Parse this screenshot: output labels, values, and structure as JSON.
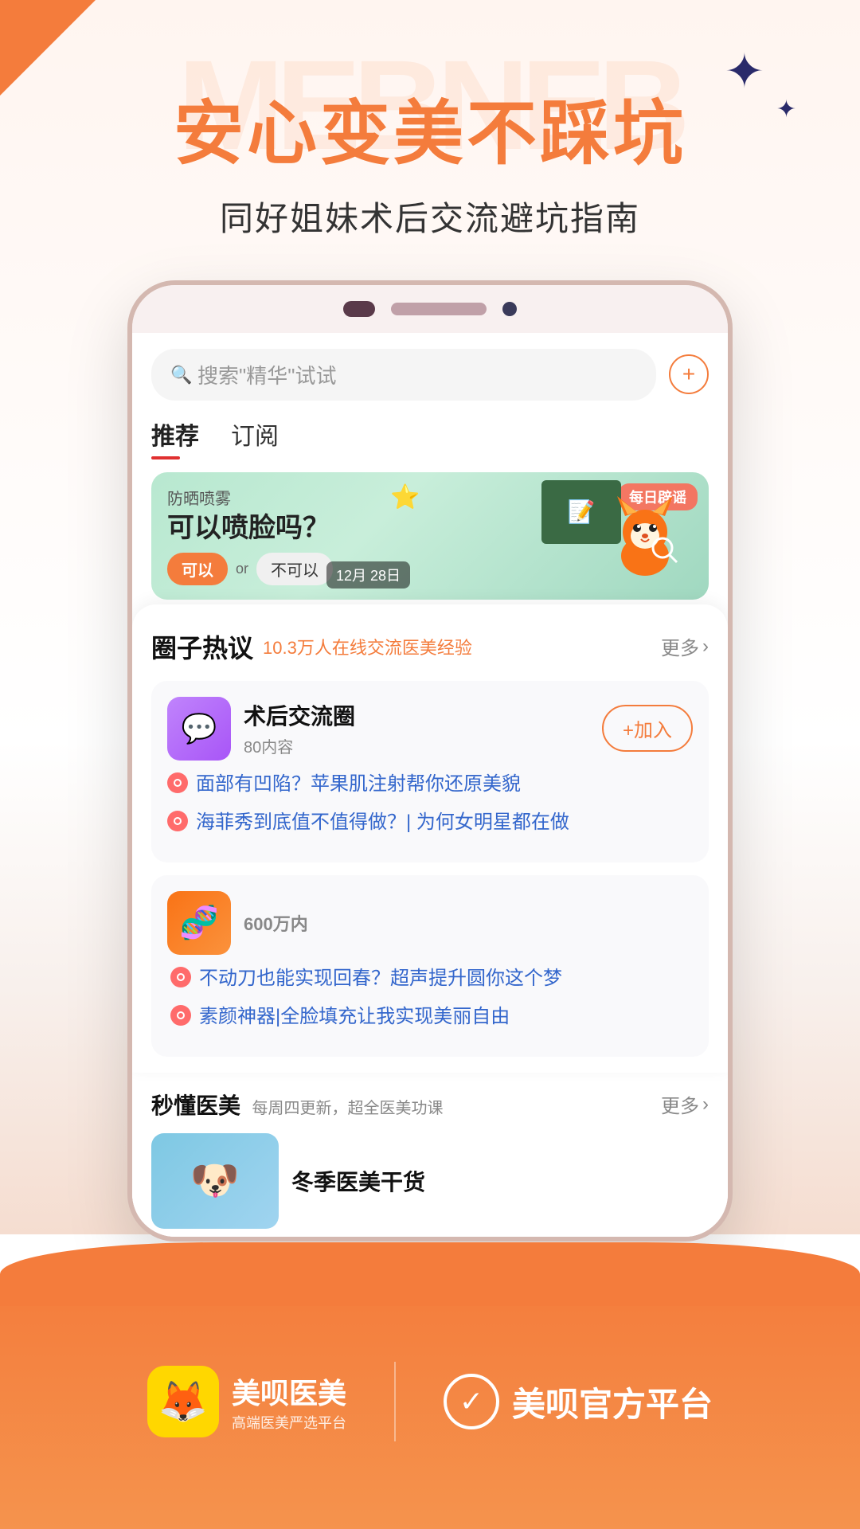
{
  "page": {
    "title": "安心变美不踩坑",
    "subtitle": "同好姐妹术后交流避坑指南",
    "watermark": "MEBNEB"
  },
  "search": {
    "placeholder": "搜索\"精华\"试试",
    "plus_label": "+"
  },
  "tabs": [
    {
      "label": "推荐",
      "active": true
    },
    {
      "label": "订阅",
      "active": false
    }
  ],
  "banner": {
    "tag": "防晒喷雾",
    "main_text": "可以喷脸吗？",
    "btn_yes": "可以",
    "btn_or": "or",
    "btn_no": "不可以",
    "date": "12月\n28日",
    "label": "每日辟谣"
  },
  "circle_section": {
    "title": "圈子热议",
    "subtitle": "10.3万人在线交流医美经验",
    "more": "更多"
  },
  "circle_groups": [
    {
      "icon": "💬",
      "name": "术后交流圈",
      "count": "80内容",
      "join_label": "+加入",
      "posts": [
        {
          "text": "面部有凹陷？苹果肌注射帮你还原美貌"
        },
        {
          "text": "海菲秀到底值不值得做？| 为何女明星都在做"
        }
      ]
    },
    {
      "icon": "🔬",
      "name": "",
      "count": "600万内",
      "join_label": "",
      "posts": [
        {
          "text": "不动刀也能实现回春？超声提升圆你这个梦"
        },
        {
          "text": "素颜神器|全脸填充让我实现美丽自由"
        }
      ]
    }
  ],
  "miemed_section": {
    "title": "秒懂医美",
    "subtitle": "每周四更新，超全医美功课",
    "more": "更多",
    "card": {
      "title": "冬季医美干货"
    }
  },
  "footer": {
    "logo_text": "美呗医美",
    "logo_tagline": "高端医美严选平台",
    "verified_text": "美呗官方平台",
    "verified_label": "✓"
  }
}
